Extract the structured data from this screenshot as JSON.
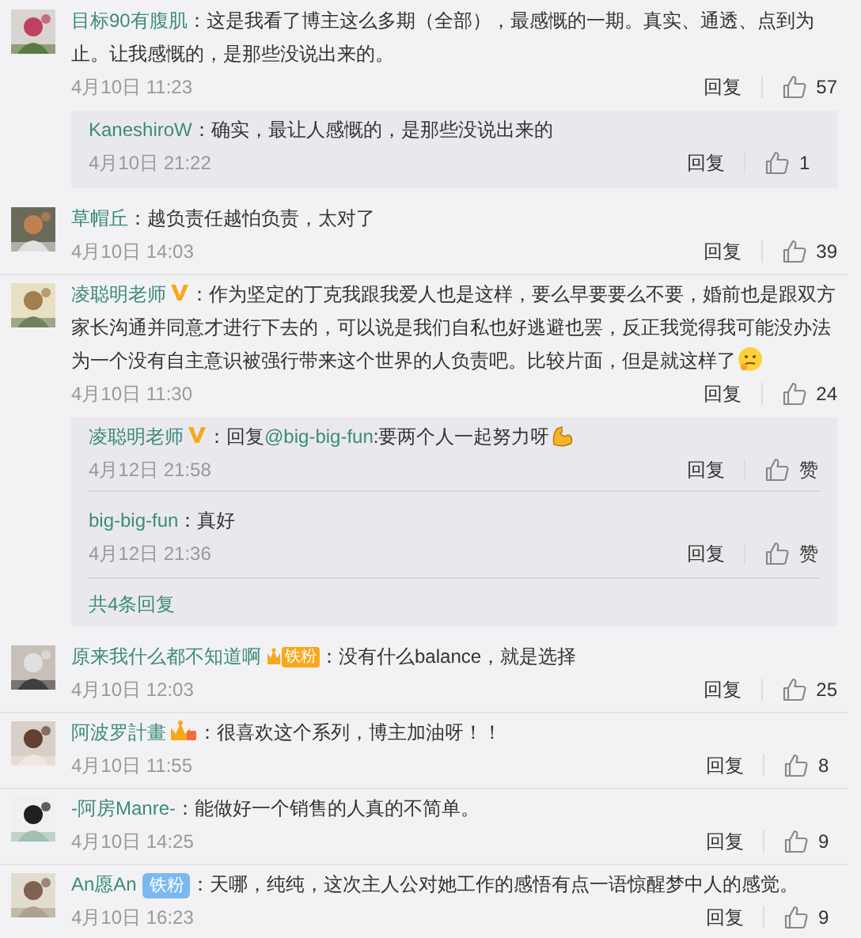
{
  "comments": [
    {
      "user": "目标90有腹肌",
      "text": "：这是我看了博主这么多期（全部），最感慨的一期。真实、通透、点到为止。让我感慨的，是那些没说出来的。",
      "date": "4月10日 11:23",
      "reply_label": "回复",
      "like": "57",
      "replies": [
        {
          "user": "KaneshiroW",
          "text": "：确实，最让人感慨的，是那些没说出来的",
          "date": "4月10日 21:22",
          "reply_label": "回复",
          "like": "1"
        }
      ]
    },
    {
      "user": "草帽丘",
      "text": "：越负责任越怕负责，太对了",
      "date": "4月10日 14:03",
      "reply_label": "回复",
      "like": "39"
    },
    {
      "user": "凌聪明老师",
      "badge": {
        "kind": "verified"
      },
      "text": "：作为坚定的丁克我跟我爱人也是这样，要么早要要么不要，婚前也是跟双方家长沟通并同意才进行下去的，可以说是我们自私也好逃避也罢，反正我觉得我可能没办法为一个没有自主意识被强行带来这个世界的人负责吧。比较片面，但是就这样了",
      "emoji": {
        "kind": "thinking"
      },
      "date": "4月10日 11:30",
      "reply_label": "回复",
      "like": "24",
      "replies": [
        {
          "user": "凌聪明老师",
          "badge": {
            "kind": "verified"
          },
          "prefix": "：回复",
          "mention": "@big-big-fun",
          "text": ":要两个人一起努力呀",
          "emoji": {
            "kind": "arm"
          },
          "date": "4月12日 21:58",
          "reply_label": "回复",
          "like": "赞"
        },
        {
          "user": "big-big-fun",
          "text": "：真好",
          "date": "4月12日 21:36",
          "reply_label": "回复",
          "like": "赞"
        }
      ],
      "more_replies": "共4条回复"
    },
    {
      "user": "原来我什么都不知道啊",
      "badge": {
        "kind": "crown_fan",
        "text": "铁粉"
      },
      "text": "：没有什么balance，就是选择",
      "date": "4月10日 12:03",
      "reply_label": "回复",
      "like": "25"
    },
    {
      "user": "阿波罗計畫",
      "badge": {
        "kind": "crown"
      },
      "text": "：很喜欢这个系列，博主加油呀！！",
      "date": "4月10日 11:55",
      "reply_label": "回复",
      "like": "8"
    },
    {
      "user": "-阿房Manre-",
      "text": "：能做好一个销售的人真的不简单。",
      "date": "4月10日 14:25",
      "reply_label": "回复",
      "like": "9"
    },
    {
      "user": "An愿An",
      "badge": {
        "kind": "fan",
        "text": "铁粉"
      },
      "text": "：天哪，纯纯，这次主人公对她工作的感悟有点一语惊醒梦中人的感觉。",
      "date": "4月10日 16:23",
      "reply_label": "回复",
      "like": "9"
    }
  ]
}
